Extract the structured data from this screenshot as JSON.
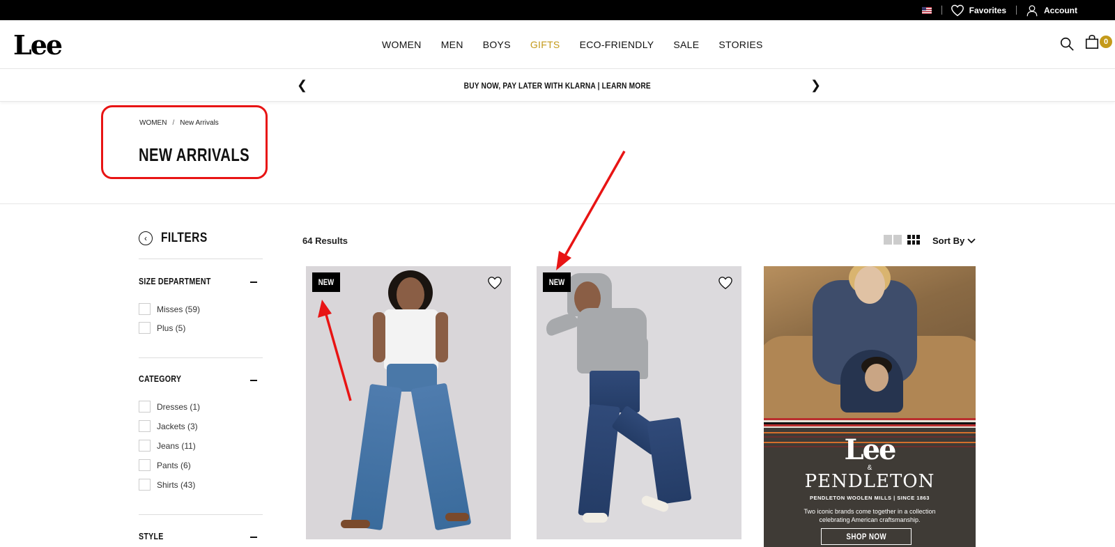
{
  "utility_bar": {
    "favorites_label": "Favorites",
    "account_label": "Account"
  },
  "header": {
    "logo_text": "Lee",
    "nav": [
      "WOMEN",
      "MEN",
      "BOYS",
      "GIFTS",
      "ECO-FRIENDLY",
      "SALE",
      "STORIES"
    ],
    "cart_count": "0",
    "accent_color": "#c49a1a"
  },
  "promo": {
    "text": "BUY NOW, PAY LATER WITH KLARNA | LEARN MORE"
  },
  "breadcrumb": {
    "root": "WOMEN",
    "separator": "/",
    "current": "New Arrivals"
  },
  "page_title": "NEW ARRIVALS",
  "filters": {
    "title": "FILTERS",
    "groups": [
      {
        "title": "SIZE DEPARTMENT",
        "options": [
          "Misses (59)",
          "Plus (5)"
        ]
      },
      {
        "title": "CATEGORY",
        "options": [
          "Dresses (1)",
          "Jackets (3)",
          "Jeans (11)",
          "Pants (6)",
          "Shirts (43)"
        ]
      },
      {
        "title": "STYLE",
        "options": []
      }
    ]
  },
  "results": {
    "count_label": "64 Results",
    "sort_label": "Sort By"
  },
  "products": [
    {
      "badge": "NEW"
    },
    {
      "badge": "NEW"
    }
  ],
  "promo_tile": {
    "brand_top": "Lee",
    "ampersand": "&",
    "brand_bottom": "PENDLETON",
    "mills": "PENDLETON WOOLEN MILLS | SINCE 1863",
    "description": "Two iconic brands come together in a collection celebrating American craftsmanship.",
    "cta": "SHOP NOW"
  },
  "annotation_color": "#e81414"
}
